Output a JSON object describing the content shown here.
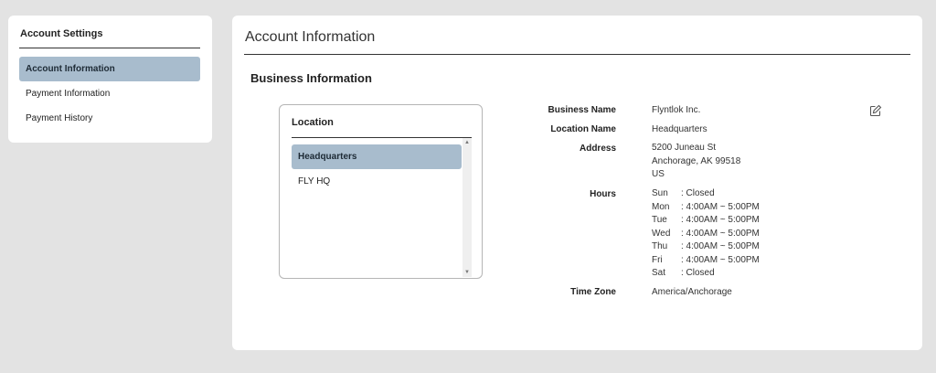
{
  "sidebar": {
    "title": "Account Settings",
    "items": [
      {
        "label": "Account Information"
      },
      {
        "label": "Payment Information"
      },
      {
        "label": "Payment History"
      }
    ]
  },
  "main": {
    "title": "Account Information",
    "section_title": "Business Information",
    "location": {
      "title": "Location",
      "items": [
        {
          "label": "Headquarters"
        },
        {
          "label": "FLY HQ"
        }
      ]
    },
    "details": {
      "business_name": {
        "label": "Business Name",
        "value": "Flyntlok Inc."
      },
      "location_name": {
        "label": "Location Name",
        "value": "Headquarters"
      },
      "address": {
        "label": "Address",
        "lines": [
          "5200 Juneau St",
          "Anchorage, AK 99518",
          "US"
        ]
      },
      "hours": {
        "label": "Hours",
        "rows": [
          {
            "day": "Sun",
            "time": ": Closed"
          },
          {
            "day": "Mon",
            "time": ": 4:00AM ~ 5:00PM"
          },
          {
            "day": "Tue",
            "time": ": 4:00AM ~ 5:00PM"
          },
          {
            "day": "Wed",
            "time": ": 4:00AM ~ 5:00PM"
          },
          {
            "day": "Thu",
            "time": ": 4:00AM ~ 5:00PM"
          },
          {
            "day": "Fri",
            "time": ": 4:00AM ~ 5:00PM"
          },
          {
            "day": "Sat",
            "time": ": Closed"
          }
        ]
      },
      "time_zone": {
        "label": "Time Zone",
        "value": "America/Anchorage"
      }
    },
    "edit_icon": "edit-icon"
  },
  "colors": {
    "accent_selected": "#a8bccd",
    "background": "#e3e3e3"
  }
}
